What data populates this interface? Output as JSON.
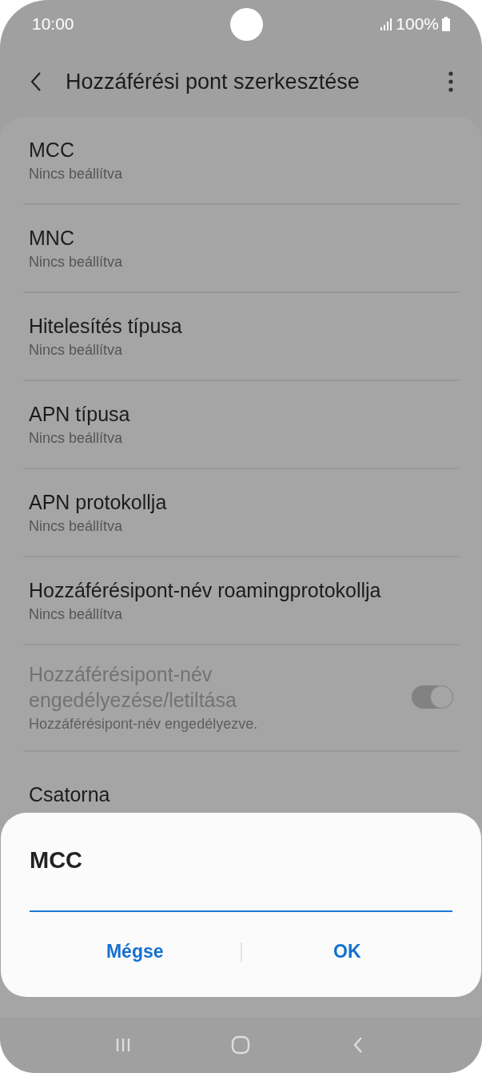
{
  "status_bar": {
    "time": "10:00",
    "battery": "100%"
  },
  "app_bar": {
    "title": "Hozzáférési pont szerkesztése"
  },
  "settings": [
    {
      "kind": "text",
      "title": "MCC",
      "subtitle": "Nincs beállítva",
      "disabled": false
    },
    {
      "kind": "text",
      "title": "MNC",
      "subtitle": "Nincs beállítva",
      "disabled": false
    },
    {
      "kind": "text",
      "title": "Hitelesítés típusa",
      "subtitle": "Nincs beállítva",
      "disabled": false
    },
    {
      "kind": "text",
      "title": "APN típusa",
      "subtitle": "Nincs beállítva",
      "disabled": false
    },
    {
      "kind": "text",
      "title": "APN protokollja",
      "subtitle": "Nincs beállítva",
      "disabled": false
    },
    {
      "kind": "text",
      "title": "Hozzáférésipont-név roamingprotokollja",
      "subtitle": "Nincs beállítva",
      "disabled": false
    },
    {
      "kind": "toggle",
      "title": "Hozzáférésipont-név engedélyezése/letiltása",
      "subtitle": "Hozzáférésipont-név engedélyezve.",
      "disabled": true,
      "on": true
    },
    {
      "kind": "text",
      "title": "Csatorna",
      "disabled": false
    }
  ],
  "dialog": {
    "title": "MCC",
    "buttons": [
      "Mégse",
      "OK"
    ]
  }
}
